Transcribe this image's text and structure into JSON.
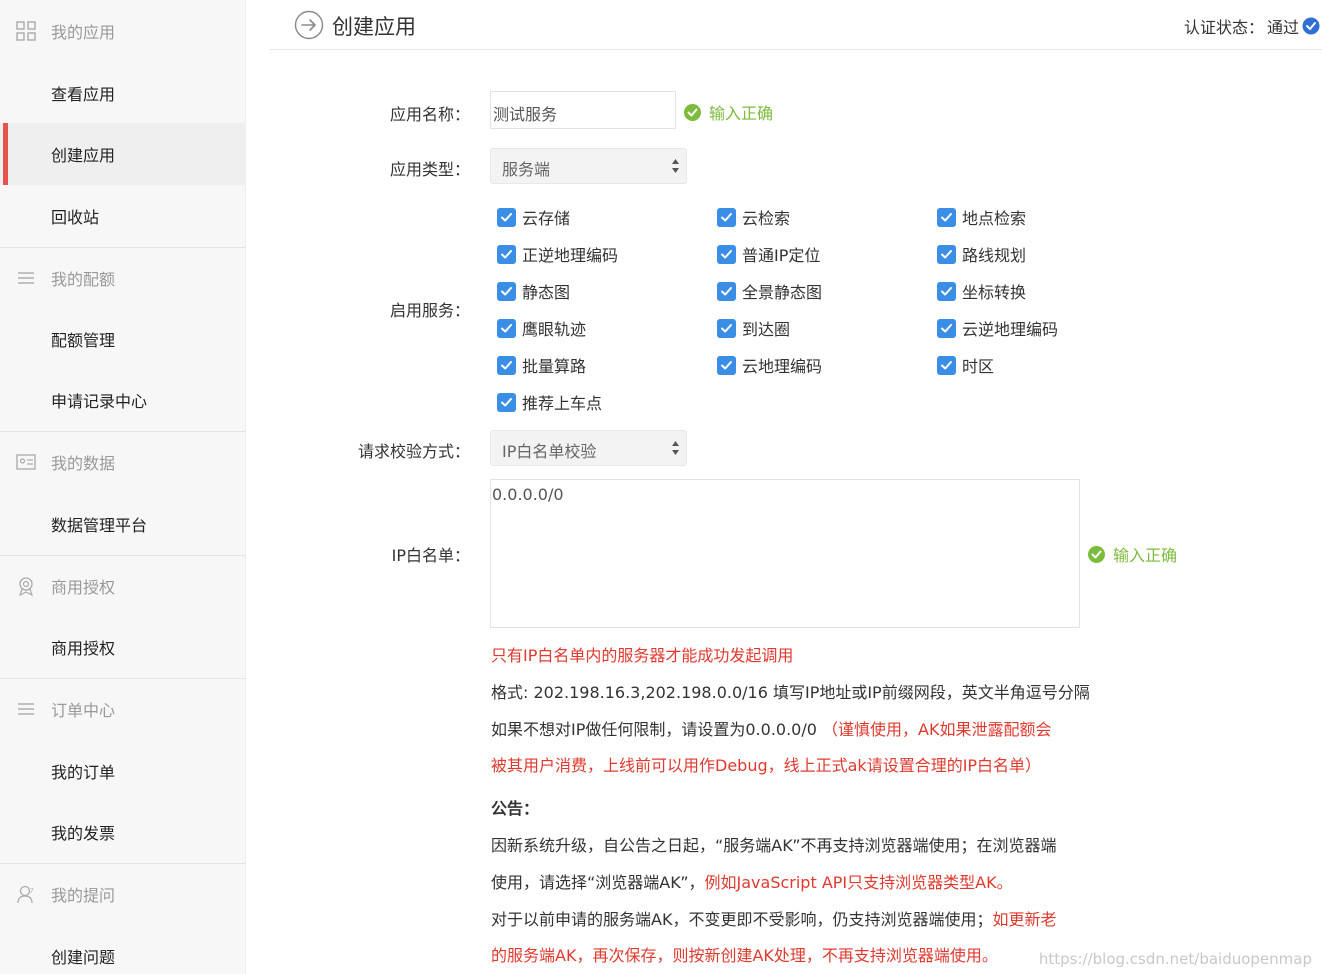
{
  "sidebar": {
    "sections": [
      {
        "title": "我的应用",
        "icon": "grid-icon",
        "items": [
          "查看应用",
          "创建应用",
          "回收站"
        ]
      },
      {
        "title": "我的配额",
        "icon": "list-icon",
        "items": [
          "配额管理",
          "申请记录中心"
        ]
      },
      {
        "title": "我的数据",
        "icon": "id-card-icon",
        "items": [
          "数据管理平台"
        ]
      },
      {
        "title": "商用授权",
        "icon": "badge-icon",
        "items": [
          "商用授权"
        ]
      },
      {
        "title": "订单中心",
        "icon": "list-icon",
        "items": [
          "我的订单",
          "我的发票"
        ]
      },
      {
        "title": "我的提问",
        "icon": "user-question-icon",
        "items": [
          "创建问题"
        ]
      }
    ],
    "active_item": "创建应用"
  },
  "header": {
    "title": "创建应用",
    "cert_label": "认证状态：",
    "cert_value": "通过"
  },
  "form": {
    "app_name_label": "应用名称：",
    "app_name_value": "测试服务",
    "app_name_ok": "输入正确",
    "app_type_label": "应用类型：",
    "app_type_value": "服务端",
    "services_label": "启用服务：",
    "services": [
      [
        "云存储",
        "云检索",
        "地点检索"
      ],
      [
        "正逆地理编码",
        "普通IP定位",
        "路线规划"
      ],
      [
        "静态图",
        "全景静态图",
        "坐标转换"
      ],
      [
        "鹰眼轨迹",
        "到达圈",
        "云逆地理编码"
      ],
      [
        "批量算路",
        "云地理编码",
        "时区"
      ],
      [
        "推荐上车点"
      ]
    ],
    "verify_label": "请求校验方式：",
    "verify_value": "IP白名单校验",
    "ip_label": "IP白名单：",
    "ip_value": "0.0.0.0/0",
    "ip_ok": "输入正确"
  },
  "notes": {
    "line1": "只有IP白名单内的服务器才能成功发起调用",
    "line2": "格式: 202.198.16.3,202.198.0.0/16 填写IP地址或IP前缀网段，英文半角逗号分隔",
    "line3_a": "如果不想对IP做任何限制，请设置为0.0.0.0/0 ",
    "line3_b": "（谨慎使用，AK如果泄露配额会",
    "line4": "被其用户消费，上线前可以用作Debug，线上正式ak请设置合理的IP白名单）",
    "notice_title": "公告：",
    "line5": "因新系统升级，自公告之日起，“服务端AK”不再支持浏览器端使用；在浏览器端",
    "line6_a": "使用，请选择“浏览器端AK”，",
    "line6_b": "例如JavaScript API只支持浏览器类型AK。",
    "line7_a": "对于以前申请的服务端AK，不变更即不受影响，仍支持浏览器端使用；",
    "line7_b": "如更新老",
    "line8": "的服务端AK，再次保存，则按新创建AK处理，不再支持浏览器端使用。"
  },
  "watermark": "https://blog.csdn.net/baiduopenmap",
  "colors": {
    "accent": "#e8544d",
    "check": "#3a8ee6",
    "ok": "#7dbb3c",
    "warn": "#e03a2f"
  }
}
